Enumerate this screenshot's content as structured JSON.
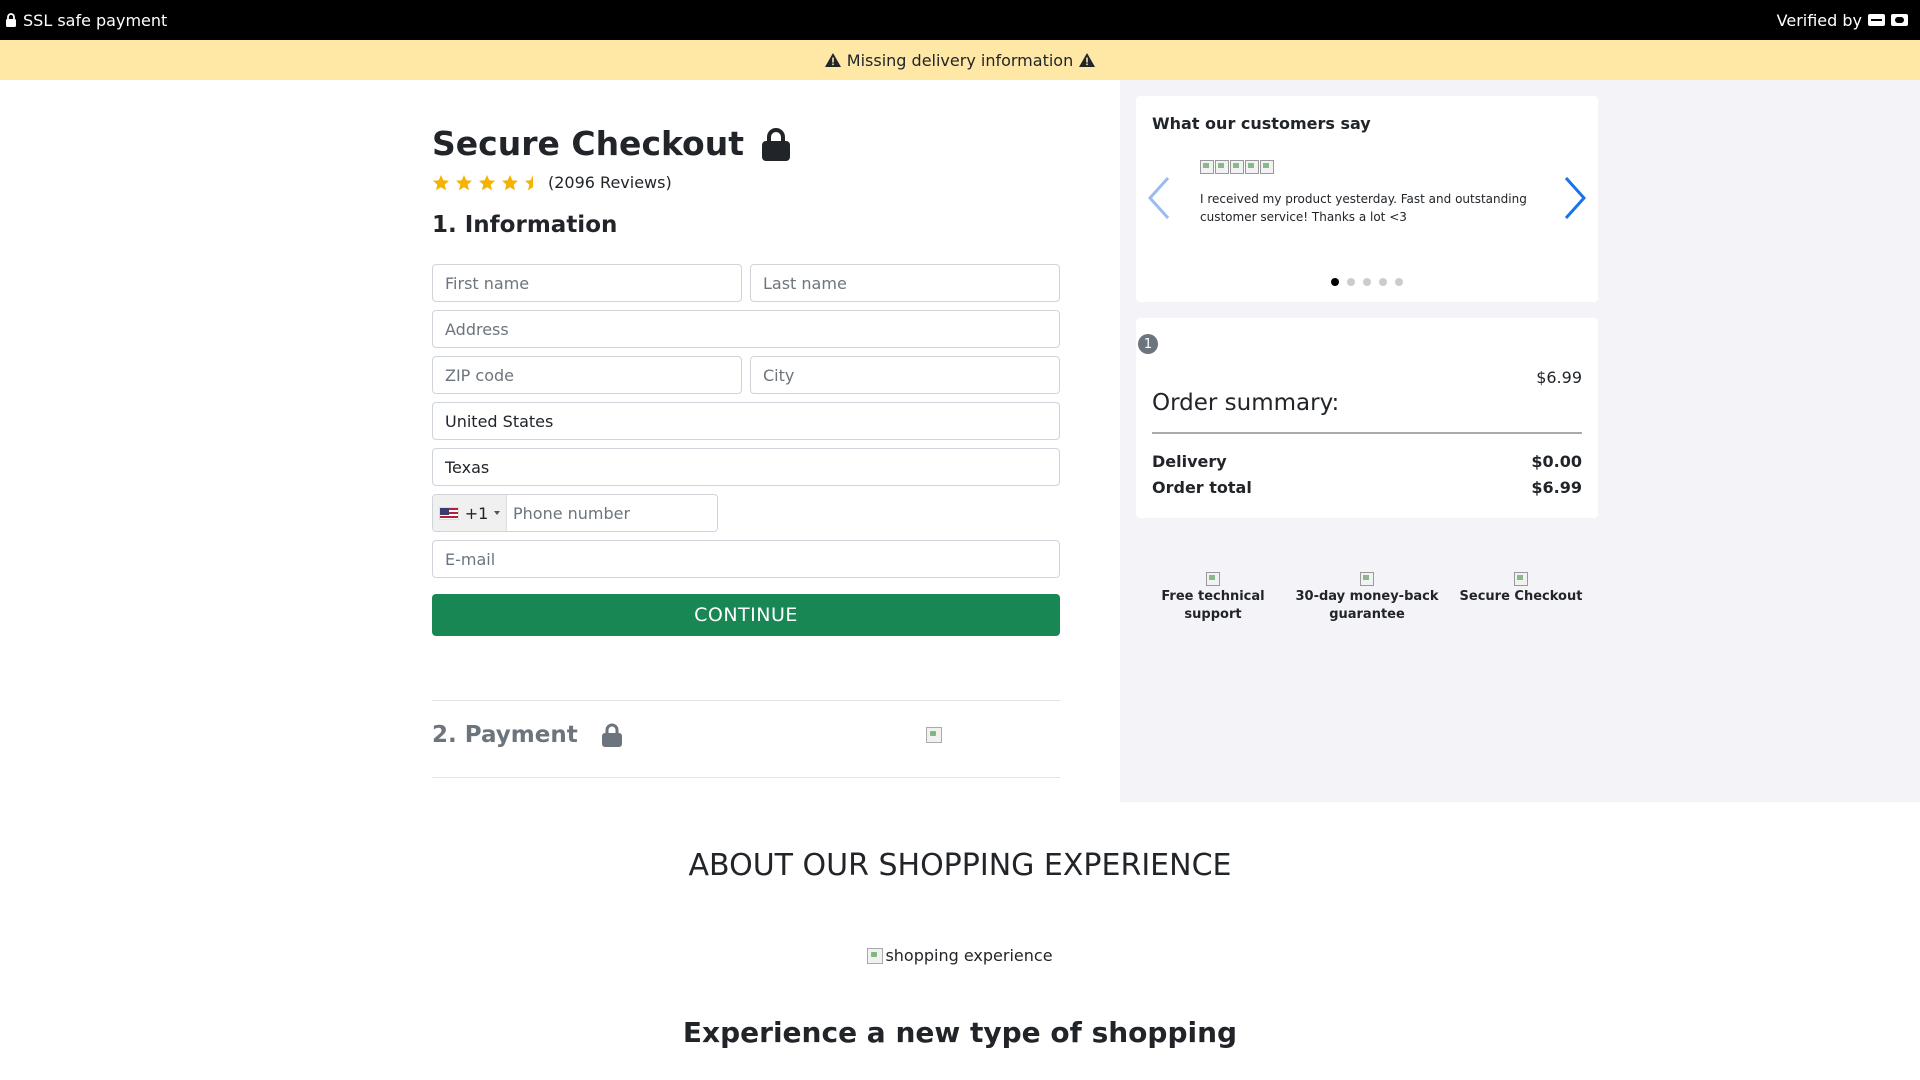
{
  "topbar": {
    "ssl_text": "SSL safe payment",
    "verified_text": "Verified by"
  },
  "banner": {
    "text": "Missing delivery information"
  },
  "checkout": {
    "title": "Secure Checkout",
    "rating": 4.5,
    "reviews_text": "(2096 Reviews)",
    "section1_title": "1. Information",
    "fields": {
      "first_name_placeholder": "First name",
      "last_name_placeholder": "Last name",
      "address_placeholder": "Address",
      "zip_placeholder": "ZIP code",
      "city_placeholder": "City",
      "country_value": "United States",
      "state_value": "Texas",
      "phone_code": "+1",
      "phone_placeholder": "Phone number",
      "email_placeholder": "E-mail"
    },
    "continue_label": "CONTINUE",
    "section2_title": "2. Payment"
  },
  "testimonials": {
    "title": "What our customers say",
    "review_text": "I received my product yesterday. Fast and outstanding customer service! Thanks a lot <3",
    "slide_count": 5,
    "active_slide": 1
  },
  "summary": {
    "quantity": "1",
    "item_price": "$6.99",
    "title": "Order summary:",
    "delivery_label": "Delivery",
    "delivery_value": "$0.00",
    "total_label": "Order total",
    "total_value": "$6.99"
  },
  "badges": [
    {
      "label": "Free technical support"
    },
    {
      "label": "30-day money-back guarantee"
    },
    {
      "label": "Secure Checkout"
    }
  ],
  "about": {
    "title": "ABOUT OUR SHOPPING EXPERIENCE",
    "image_alt": "shopping experience",
    "subtitle": "Experience a new type of shopping"
  },
  "colors": {
    "accent_green": "#198754",
    "banner_yellow": "#ffe8a6",
    "star_gold": "#f5b301",
    "arrow_blue": "#1a73e8"
  },
  "icons": {
    "ssl": "lock-icon",
    "warning": "warning-icon",
    "visa": "visa-card-icon",
    "mastercard": "mastercard-icon",
    "title_lock": "lock-icon",
    "payment_lock": "lock-icon",
    "prev": "chevron-left-icon",
    "next": "chevron-right-icon"
  }
}
